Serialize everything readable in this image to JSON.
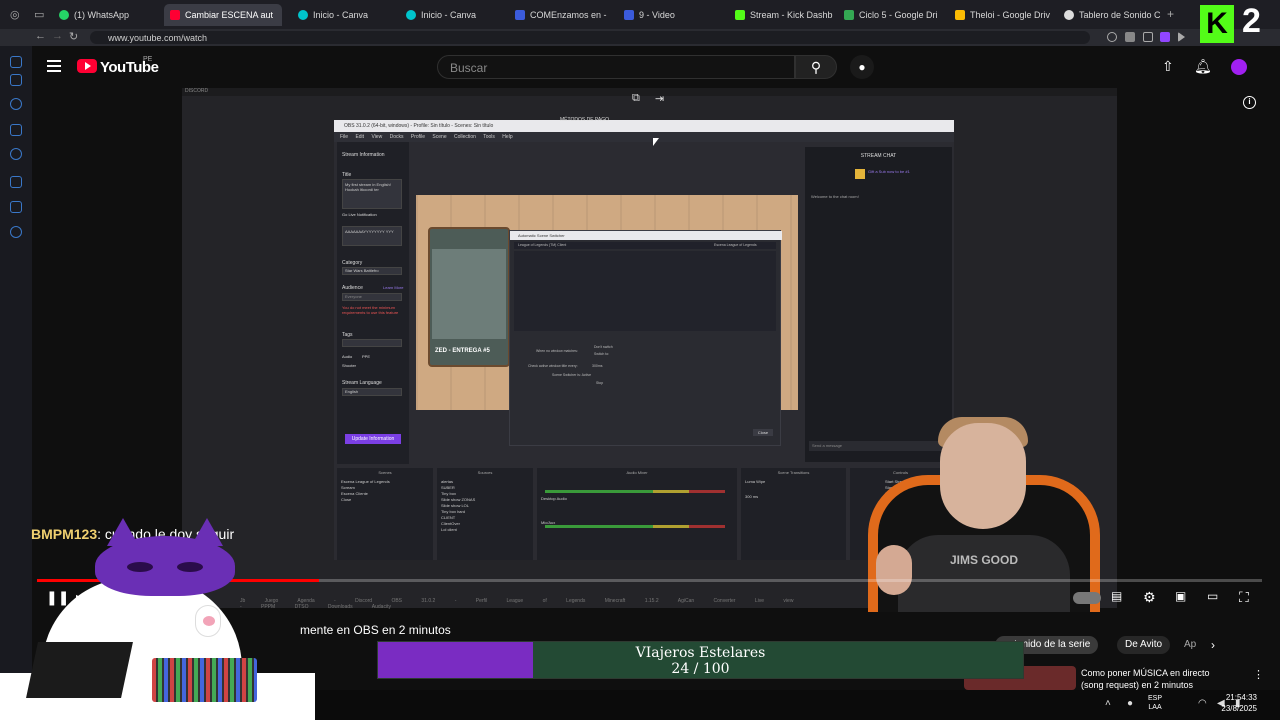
{
  "browser": {
    "tabs": [
      {
        "label": "(1) WhatsApp",
        "color": "#25d366"
      },
      {
        "label": "Cambiar ESCENA aut",
        "color": "#ff0033"
      },
      {
        "label": "Inicio - Canva",
        "color": "#00c4cc"
      },
      {
        "label": "Inicio - Canva",
        "color": "#00c4cc"
      },
      {
        "label": "COMEnzamos en -",
        "color": "#3b5bdb"
      },
      {
        "label": "9 - Video",
        "color": "#3b5bdb"
      },
      {
        "label": "Stream - Kick Dashb",
        "color": "#53fc18"
      },
      {
        "label": "Ciclo 5 - Google Dri",
        "color": "#34a853"
      },
      {
        "label": "Theloi - Google Driv",
        "color": "#fbbc04"
      },
      {
        "label": "Tablero de Sonido C",
        "color": "#dddddd"
      }
    ],
    "url": "www.youtube.com/watch",
    "new_tab": "+"
  },
  "kick_overlay": {
    "letter": "K",
    "count": "2"
  },
  "youtube": {
    "logo_text": "YouTube",
    "country": "PE",
    "search_placeholder": "Buscar",
    "icons": [
      "hamburger-icon",
      "search-icon",
      "mic-icon",
      "upload-icon",
      "bell-icon",
      "avatar"
    ]
  },
  "video": {
    "top_label": "DISCORD",
    "obs": {
      "title": "OBS 31.0.2 (64-bit, windows) - Profile: Sin título - Scenes: Sin título",
      "menu": "File Edit View Docks Profile Scene Collection Tools Help",
      "overlay_label": "MÉTODOS DE PAGO",
      "stream_info_header": "Stream Information",
      "title_label": "Title",
      "title_value": "My first stream in English! Hookah Itkoordi ter",
      "golive_label": "Go Live Notification",
      "golive_value": "AAAAAAAYYYYYYYY YYY",
      "category_label": "Category",
      "category_value": "Star Wars Battlefro",
      "audience_label": "Audience",
      "audience_value": "Everyone",
      "audience_warning": "You do not meet the minimum requirements to use this feature",
      "tags_label": "Tags",
      "tags": [
        "Español",
        "Audio",
        "PPE",
        "Shooter"
      ],
      "language_label": "Stream Language",
      "language_value": "English",
      "update_button": "Update Information",
      "learn_more": "Learn More",
      "card_caption": "ZED - ENTREGA #5",
      "dialog_title": "Automatic Scene Switcher",
      "dialog_window": "League of Legends (TM) Client",
      "dialog_scene": "Escena League of Legends",
      "dialog_no_match": "When no window matches:",
      "dialog_dont_switch": "Don't switch",
      "dialog_switch_to": "Switch to:",
      "dialog_check": "Check active window title every:",
      "dialog_interval": "300ms",
      "dialog_status": "Scene Switcher is: Active",
      "dialog_stop": "Stop",
      "dialog_close": "Close",
      "chat_header": "STREAM CHAT",
      "chat_gift": "Gift a Sub now to be #1",
      "chat_welcome": "Welcome to the chat room!",
      "chat_send": "Send a message",
      "docks": [
        "Scenes",
        "Sources",
        "Audio Mixer",
        "Scene Transitions",
        "Controls"
      ],
      "scenes": [
        "Escena League of Legends",
        "Scream",
        "Escena Cliente",
        "Close"
      ],
      "sources": [
        "alertas",
        "SUBER",
        "Tiny box",
        "Slide show ZONAS",
        "Slide show LOL",
        "Tiny box hard",
        "CLIENT",
        "ClientOver",
        "Lol client"
      ],
      "mixer": [
        "Desktop Audio",
        "Mic/Aux"
      ],
      "transitions": [
        "Luma Wipe",
        "300 ms"
      ],
      "controls": [
        "Start Streaming",
        "Start Recording",
        "Studio Mode",
        "Settings",
        "Exit"
      ],
      "taskbar_items": [
        "Jb",
        "Juego",
        "Agenda - Discord",
        "OBS 31.0.2 - Perfil",
        "League of Legends",
        "Minecraft 1.15.2",
        "AgiCan Converter",
        "Live view - PPPM",
        "DTSO",
        "Downloads",
        "Audacity"
      ]
    }
  },
  "player": {
    "played_fraction": 0.23,
    "icons": [
      "pause-icon",
      "next-icon",
      "autoplay-toggle",
      "subtitles-icon",
      "settings-icon",
      "miniplayer-icon",
      "theater-icon",
      "fullscreen-icon"
    ]
  },
  "overlays": {
    "chat_user": "BMPM123",
    "chat_text": ": cuando le doy seguir",
    "subtitle": "mente en OBS en 2 minutos",
    "goal_title": "VIajeros Estelares",
    "goal_count": "24 / 100",
    "goal_fraction": 0.24,
    "goal_fill_color": "#7a2cc2",
    "goal_bg_color": "#234a34",
    "chip_partial": "ontenido de la serie",
    "chip_avito": "De Avito",
    "chip_ap": "Ap",
    "rec_title": "Como poner MÚSICA en directo (song request) en 2 minutos",
    "streamer_shirt": "JIMS GOOD"
  },
  "taskbar": {
    "lang_top": "ESP",
    "lang_bottom": "LAA",
    "time": "21:54:33",
    "date": "23/8/2025"
  }
}
